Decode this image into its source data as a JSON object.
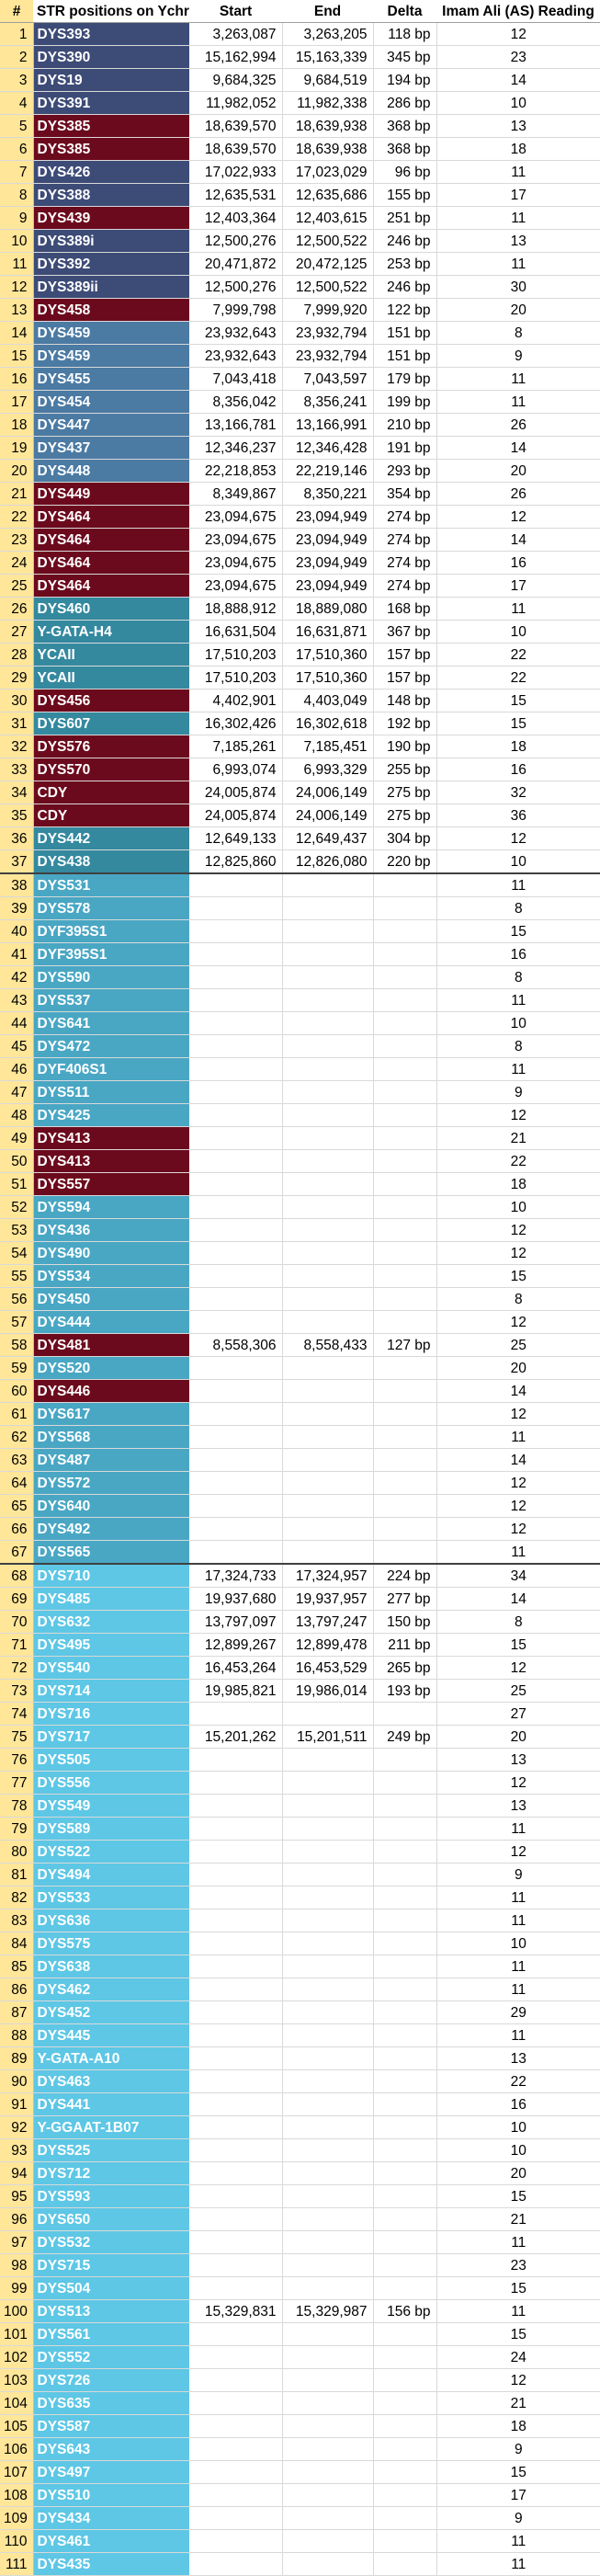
{
  "headers": [
    "#",
    "STR positions on Ychr",
    "Start",
    "End",
    "Delta",
    "Imam Ali (AS) Reading"
  ],
  "colors": {
    "navy": "#3d4b77",
    "red": "#6c0a1d",
    "steel": "#4b7aa3",
    "teal": "#34899f",
    "sky": "#49a7c4",
    "light": "#5ec7e5",
    "index_bg": "#ffe699"
  },
  "rows": [
    [
      "1",
      "DYS393",
      "3,263,087",
      "3,263,205",
      "118 bp",
      "12"
    ],
    [
      "2",
      "DYS390",
      "15,162,994",
      "15,163,339",
      "345 bp",
      "23"
    ],
    [
      "3",
      "DYS19",
      "9,684,325",
      "9,684,519",
      "194 bp",
      "14"
    ],
    [
      "4",
      "DYS391",
      "11,982,052",
      "11,982,338",
      "286 bp",
      "10"
    ],
    [
      "5",
      "DYS385",
      "18,639,570",
      "18,639,938",
      "368 bp",
      "13"
    ],
    [
      "6",
      "DYS385",
      "18,639,570",
      "18,639,938",
      "368 bp",
      "18"
    ],
    [
      "7",
      "DYS426",
      "17,022,933",
      "17,023,029",
      "96 bp",
      "11"
    ],
    [
      "8",
      "DYS388",
      "12,635,531",
      "12,635,686",
      "155 bp",
      "17"
    ],
    [
      "9",
      "DYS439",
      "12,403,364",
      "12,403,615",
      "251 bp",
      "11"
    ],
    [
      "10",
      "DYS389i",
      "12,500,276",
      "12,500,522",
      "246 bp",
      "13"
    ],
    [
      "11",
      "DYS392",
      "20,471,872",
      "20,472,125",
      "253 bp",
      "11"
    ],
    [
      "12",
      "DYS389ii",
      "12,500,276",
      "12,500,522",
      "246 bp",
      "30"
    ],
    [
      "13",
      "DYS458",
      "7,999,798",
      "7,999,920",
      "122 bp",
      "20"
    ],
    [
      "14",
      "DYS459",
      "23,932,643",
      "23,932,794",
      "151 bp",
      "8"
    ],
    [
      "15",
      "DYS459",
      "23,932,643",
      "23,932,794",
      "151 bp",
      "9"
    ],
    [
      "16",
      "DYS455",
      "7,043,418",
      "7,043,597",
      "179 bp",
      "11"
    ],
    [
      "17",
      "DYS454",
      "8,356,042",
      "8,356,241",
      "199 bp",
      "11"
    ],
    [
      "18",
      "DYS447",
      "13,166,781",
      "13,166,991",
      "210 bp",
      "26"
    ],
    [
      "19",
      "DYS437",
      "12,346,237",
      "12,346,428",
      "191 bp",
      "14"
    ],
    [
      "20",
      "DYS448",
      "22,218,853",
      "22,219,146",
      "293 bp",
      "20"
    ],
    [
      "21",
      "DYS449",
      "8,349,867",
      "8,350,221",
      "354 bp",
      "26"
    ],
    [
      "22",
      "DYS464",
      "23,094,675",
      "23,094,949",
      "274 bp",
      "12"
    ],
    [
      "23",
      "DYS464",
      "23,094,675",
      "23,094,949",
      "274 bp",
      "14"
    ],
    [
      "24",
      "DYS464",
      "23,094,675",
      "23,094,949",
      "274 bp",
      "16"
    ],
    [
      "25",
      "DYS464",
      "23,094,675",
      "23,094,949",
      "274 bp",
      "17"
    ],
    [
      "26",
      "DYS460",
      "18,888,912",
      "18,889,080",
      "168 bp",
      "11"
    ],
    [
      "27",
      "Y-GATA-H4",
      "16,631,504",
      "16,631,871",
      "367 bp",
      "10"
    ],
    [
      "28",
      "YCAII",
      "17,510,203",
      "17,510,360",
      "157 bp",
      "22"
    ],
    [
      "29",
      "YCAII",
      "17,510,203",
      "17,510,360",
      "157 bp",
      "22"
    ],
    [
      "30",
      "DYS456",
      "4,402,901",
      "4,403,049",
      "148 bp",
      "15"
    ],
    [
      "31",
      "DYS607",
      "16,302,426",
      "16,302,618",
      "192 bp",
      "15"
    ],
    [
      "32",
      "DYS576",
      "7,185,261",
      "7,185,451",
      "190 bp",
      "18"
    ],
    [
      "33",
      "DYS570",
      "6,993,074",
      "6,993,329",
      "255 bp",
      "16"
    ],
    [
      "34",
      "CDY",
      "24,005,874",
      "24,006,149",
      "275 bp",
      "32"
    ],
    [
      "35",
      "CDY",
      "24,005,874",
      "24,006,149",
      "275 bp",
      "36"
    ],
    [
      "36",
      "DYS442",
      "12,649,133",
      "12,649,437",
      "304 bp",
      "12"
    ],
    [
      "37",
      "DYS438",
      "12,825,860",
      "12,826,080",
      "220 bp",
      "10"
    ],
    [
      "38",
      "DYS531",
      "",
      "",
      "",
      "11"
    ],
    [
      "39",
      "DYS578",
      "",
      "",
      "",
      "8"
    ],
    [
      "40",
      "DYF395S1",
      "",
      "",
      "",
      "15"
    ],
    [
      "41",
      "DYF395S1",
      "",
      "",
      "",
      "16"
    ],
    [
      "42",
      "DYS590",
      "",
      "",
      "",
      "8"
    ],
    [
      "43",
      "DYS537",
      "",
      "",
      "",
      "11"
    ],
    [
      "44",
      "DYS641",
      "",
      "",
      "",
      "10"
    ],
    [
      "45",
      "DYS472",
      "",
      "",
      "",
      "8"
    ],
    [
      "46",
      "DYF406S1",
      "",
      "",
      "",
      "11"
    ],
    [
      "47",
      "DYS511",
      "",
      "",
      "",
      "9"
    ],
    [
      "48",
      "DYS425",
      "",
      "",
      "",
      "12"
    ],
    [
      "49",
      "DYS413",
      "",
      "",
      "",
      "21"
    ],
    [
      "50",
      "DYS413",
      "",
      "",
      "",
      "22"
    ],
    [
      "51",
      "DYS557",
      "",
      "",
      "",
      "18"
    ],
    [
      "52",
      "DYS594",
      "",
      "",
      "",
      "10"
    ],
    [
      "53",
      "DYS436",
      "",
      "",
      "",
      "12"
    ],
    [
      "54",
      "DYS490",
      "",
      "",
      "",
      "12"
    ],
    [
      "55",
      "DYS534",
      "",
      "",
      "",
      "15"
    ],
    [
      "56",
      "DYS450",
      "",
      "",
      "",
      "8"
    ],
    [
      "57",
      "DYS444",
      "",
      "",
      "",
      "12"
    ],
    [
      "58",
      "DYS481",
      "8,558,306",
      "8,558,433",
      "127 bp",
      "25"
    ],
    [
      "59",
      "DYS520",
      "",
      "",
      "",
      "20"
    ],
    [
      "60",
      "DYS446",
      "",
      "",
      "",
      "14"
    ],
    [
      "61",
      "DYS617",
      "",
      "",
      "",
      "12"
    ],
    [
      "62",
      "DYS568",
      "",
      "",
      "",
      "11"
    ],
    [
      "63",
      "DYS487",
      "",
      "",
      "",
      "14"
    ],
    [
      "64",
      "DYS572",
      "",
      "",
      "",
      "12"
    ],
    [
      "65",
      "DYS640",
      "",
      "",
      "",
      "12"
    ],
    [
      "66",
      "DYS492",
      "",
      "",
      "",
      "12"
    ],
    [
      "67",
      "DYS565",
      "",
      "",
      "",
      "11"
    ],
    [
      "68",
      "DYS710",
      "17,324,733",
      "17,324,957",
      "224 bp",
      "34"
    ],
    [
      "69",
      "DYS485",
      "19,937,680",
      "19,937,957",
      "277 bp",
      "14"
    ],
    [
      "70",
      "DYS632",
      "13,797,097",
      "13,797,247",
      "150 bp",
      "8"
    ],
    [
      "71",
      "DYS495",
      "12,899,267",
      "12,899,478",
      "211 bp",
      "15"
    ],
    [
      "72",
      "DYS540",
      "16,453,264",
      "16,453,529",
      "265 bp",
      "12"
    ],
    [
      "73",
      "DYS714",
      "19,985,821",
      "19,986,014",
      "193 bp",
      "25"
    ],
    [
      "74",
      "DYS716",
      "",
      "",
      "",
      "27"
    ],
    [
      "75",
      "DYS717",
      "15,201,262",
      "15,201,511",
      "249 bp",
      "20"
    ],
    [
      "76",
      "DYS505",
      "",
      "",
      "",
      "13"
    ],
    [
      "77",
      "DYS556",
      "",
      "",
      "",
      "12"
    ],
    [
      "78",
      "DYS549",
      "",
      "",
      "",
      "13"
    ],
    [
      "79",
      "DYS589",
      "",
      "",
      "",
      "11"
    ],
    [
      "80",
      "DYS522",
      "",
      "",
      "",
      "12"
    ],
    [
      "81",
      "DYS494",
      "",
      "",
      "",
      "9"
    ],
    [
      "82",
      "DYS533",
      "",
      "",
      "",
      "11"
    ],
    [
      "83",
      "DYS636",
      "",
      "",
      "",
      "11"
    ],
    [
      "84",
      "DYS575",
      "",
      "",
      "",
      "10"
    ],
    [
      "85",
      "DYS638",
      "",
      "",
      "",
      "11"
    ],
    [
      "86",
      "DYS462",
      "",
      "",
      "",
      "11"
    ],
    [
      "87",
      "DYS452",
      "",
      "",
      "",
      "29"
    ],
    [
      "88",
      "DYS445",
      "",
      "",
      "",
      "11"
    ],
    [
      "89",
      "Y-GATA-A10",
      "",
      "",
      "",
      "13"
    ],
    [
      "90",
      "DYS463",
      "",
      "",
      "",
      "22"
    ],
    [
      "91",
      "DYS441",
      "",
      "",
      "",
      "16"
    ],
    [
      "92",
      "Y-GGAAT-1B07",
      "",
      "",
      "",
      "10"
    ],
    [
      "93",
      "DYS525",
      "",
      "",
      "",
      "10"
    ],
    [
      "94",
      "DYS712",
      "",
      "",
      "",
      "20"
    ],
    [
      "95",
      "DYS593",
      "",
      "",
      "",
      "15"
    ],
    [
      "96",
      "DYS650",
      "",
      "",
      "",
      "21"
    ],
    [
      "97",
      "DYS532",
      "",
      "",
      "",
      "11"
    ],
    [
      "98",
      "DYS715",
      "",
      "",
      "",
      "23"
    ],
    [
      "99",
      "DYS504",
      "",
      "",
      "",
      "15"
    ],
    [
      "100",
      "DYS513",
      "15,329,831",
      "15,329,987",
      "156 bp",
      "11"
    ],
    [
      "101",
      "DYS561",
      "",
      "",
      "",
      "15"
    ],
    [
      "102",
      "DYS552",
      "",
      "",
      "",
      "24"
    ],
    [
      "103",
      "DYS726",
      "",
      "",
      "",
      "12"
    ],
    [
      "104",
      "DYS635",
      "",
      "",
      "",
      "21"
    ],
    [
      "105",
      "DYS587",
      "",
      "",
      "",
      "18"
    ],
    [
      "106",
      "DYS643",
      "",
      "",
      "",
      "9"
    ],
    [
      "107",
      "DYS497",
      "",
      "",
      "",
      "15"
    ],
    [
      "108",
      "DYS510",
      "",
      "",
      "",
      "17"
    ],
    [
      "109",
      "DYS434",
      "",
      "",
      "",
      "9"
    ],
    [
      "110",
      "DYS461",
      "",
      "",
      "",
      "11"
    ],
    [
      "111",
      "DYS435",
      "",
      "",
      "",
      "11"
    ]
  ]
}
